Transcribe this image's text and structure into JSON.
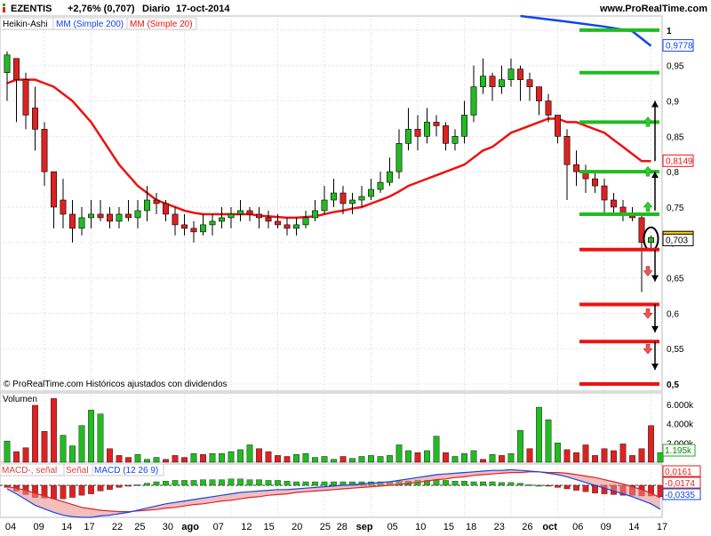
{
  "header": {
    "ticker": "EZENTIS",
    "change": "+2,76% (0,707)",
    "period": "Diario",
    "date": "17-oct-2014",
    "site": "www.ProRealTime.com"
  },
  "legend": {
    "heikin": "Heikin-Ashi",
    "sma200": "MM (Simple 200)",
    "sma20": "MM (Simple 20)"
  },
  "footer_note": "© ProRealTime.com  Históricos ajustados con dividendos",
  "colors": {
    "up": "#22bb22",
    "down": "#dd2222",
    "sma20": "#ee1111",
    "sma200": "#1144ee",
    "grid": "#d8d8d8",
    "volume_up": "#22bb22",
    "volume_down": "#dd2222"
  },
  "chart_data": [
    {
      "type": "candlestick",
      "title": "EZENTIS",
      "ylim": [
        0.49,
        1.02
      ],
      "yticks": [
        "1",
        "0,95",
        "0,9",
        "0,85",
        "0,8",
        "0,75",
        "0,7",
        "0,65",
        "0,6",
        "0,55",
        "0,5"
      ],
      "ytick_values": [
        1,
        0.95,
        0.9,
        0.85,
        0.8,
        0.75,
        0.7,
        0.65,
        0.6,
        0.55,
        0.5
      ],
      "price_tags": [
        {
          "label": "0,9778",
          "value": 0.9778,
          "color": "#1144ee"
        },
        {
          "label": "0,8149",
          "value": 0.8149,
          "color": "#ee1111"
        },
        {
          "label": "0,707",
          "value": 0.707,
          "color": "#000000",
          "highlight": true
        },
        {
          "label": "0,703",
          "value": 0.703,
          "color": "#000000"
        }
      ],
      "x_labels": [
        "04",
        "09",
        "14",
        "17",
        "22",
        "25",
        "30",
        "ago",
        "07",
        "12",
        "15",
        "20",
        "25",
        "28",
        "sep",
        "05",
        "10",
        "15",
        "18",
        "23",
        "26",
        "oct",
        "06",
        "09",
        "14",
        "17"
      ],
      "candles": [
        {
          "o": 0.94,
          "c": 0.965,
          "h": 0.97,
          "l": 0.9
        },
        {
          "o": 0.96,
          "c": 0.93,
          "h": 0.96,
          "l": 0.87
        },
        {
          "o": 0.93,
          "c": 0.88,
          "h": 0.94,
          "l": 0.86
        },
        {
          "o": 0.89,
          "c": 0.86,
          "h": 0.92,
          "l": 0.83
        },
        {
          "o": 0.86,
          "c": 0.8,
          "h": 0.87,
          "l": 0.78
        },
        {
          "o": 0.8,
          "c": 0.75,
          "h": 0.8,
          "l": 0.72
        },
        {
          "o": 0.76,
          "c": 0.74,
          "h": 0.79,
          "l": 0.72
        },
        {
          "o": 0.74,
          "c": 0.72,
          "h": 0.76,
          "l": 0.7
        },
        {
          "o": 0.72,
          "c": 0.735,
          "h": 0.75,
          "l": 0.71
        },
        {
          "o": 0.735,
          "c": 0.74,
          "h": 0.76,
          "l": 0.72
        },
        {
          "o": 0.74,
          "c": 0.735,
          "h": 0.76,
          "l": 0.73
        },
        {
          "o": 0.74,
          "c": 0.73,
          "h": 0.75,
          "l": 0.72
        },
        {
          "o": 0.73,
          "c": 0.74,
          "h": 0.75,
          "l": 0.72
        },
        {
          "o": 0.74,
          "c": 0.735,
          "h": 0.76,
          "l": 0.73
        },
        {
          "o": 0.735,
          "c": 0.745,
          "h": 0.76,
          "l": 0.72
        },
        {
          "o": 0.745,
          "c": 0.76,
          "h": 0.78,
          "l": 0.73
        },
        {
          "o": 0.76,
          "c": 0.755,
          "h": 0.77,
          "l": 0.74
        },
        {
          "o": 0.755,
          "c": 0.74,
          "h": 0.76,
          "l": 0.73
        },
        {
          "o": 0.74,
          "c": 0.725,
          "h": 0.75,
          "l": 0.71
        },
        {
          "o": 0.725,
          "c": 0.72,
          "h": 0.74,
          "l": 0.71
        },
        {
          "o": 0.72,
          "c": 0.715,
          "h": 0.73,
          "l": 0.7
        },
        {
          "o": 0.715,
          "c": 0.725,
          "h": 0.74,
          "l": 0.71
        },
        {
          "o": 0.725,
          "c": 0.73,
          "h": 0.74,
          "l": 0.71
        },
        {
          "o": 0.73,
          "c": 0.735,
          "h": 0.75,
          "l": 0.72
        },
        {
          "o": 0.735,
          "c": 0.74,
          "h": 0.75,
          "l": 0.72
        },
        {
          "o": 0.74,
          "c": 0.745,
          "h": 0.76,
          "l": 0.73
        },
        {
          "o": 0.745,
          "c": 0.74,
          "h": 0.75,
          "l": 0.73
        },
        {
          "o": 0.74,
          "c": 0.735,
          "h": 0.75,
          "l": 0.72
        },
        {
          "o": 0.735,
          "c": 0.73,
          "h": 0.745,
          "l": 0.72
        },
        {
          "o": 0.73,
          "c": 0.725,
          "h": 0.74,
          "l": 0.72
        },
        {
          "o": 0.725,
          "c": 0.72,
          "h": 0.735,
          "l": 0.71
        },
        {
          "o": 0.72,
          "c": 0.725,
          "h": 0.735,
          "l": 0.71
        },
        {
          "o": 0.725,
          "c": 0.735,
          "h": 0.745,
          "l": 0.72
        },
        {
          "o": 0.735,
          "c": 0.745,
          "h": 0.76,
          "l": 0.73
        },
        {
          "o": 0.745,
          "c": 0.76,
          "h": 0.78,
          "l": 0.74
        },
        {
          "o": 0.76,
          "c": 0.77,
          "h": 0.79,
          "l": 0.75
        },
        {
          "o": 0.77,
          "c": 0.755,
          "h": 0.78,
          "l": 0.74
        },
        {
          "o": 0.755,
          "c": 0.76,
          "h": 0.77,
          "l": 0.74
        },
        {
          "o": 0.76,
          "c": 0.765,
          "h": 0.78,
          "l": 0.75
        },
        {
          "o": 0.765,
          "c": 0.775,
          "h": 0.79,
          "l": 0.76
        },
        {
          "o": 0.775,
          "c": 0.785,
          "h": 0.8,
          "l": 0.77
        },
        {
          "o": 0.785,
          "c": 0.8,
          "h": 0.82,
          "l": 0.78
        },
        {
          "o": 0.8,
          "c": 0.84,
          "h": 0.86,
          "l": 0.79
        },
        {
          "o": 0.84,
          "c": 0.86,
          "h": 0.89,
          "l": 0.83
        },
        {
          "o": 0.86,
          "c": 0.85,
          "h": 0.88,
          "l": 0.83
        },
        {
          "o": 0.85,
          "c": 0.87,
          "h": 0.89,
          "l": 0.84
        },
        {
          "o": 0.87,
          "c": 0.865,
          "h": 0.88,
          "l": 0.85
        },
        {
          "o": 0.865,
          "c": 0.84,
          "h": 0.87,
          "l": 0.83
        },
        {
          "o": 0.84,
          "c": 0.85,
          "h": 0.86,
          "l": 0.83
        },
        {
          "o": 0.85,
          "c": 0.88,
          "h": 0.9,
          "l": 0.84
        },
        {
          "o": 0.88,
          "c": 0.92,
          "h": 0.95,
          "l": 0.87
        },
        {
          "o": 0.92,
          "c": 0.935,
          "h": 0.96,
          "l": 0.91
        },
        {
          "o": 0.935,
          "c": 0.92,
          "h": 0.94,
          "l": 0.9
        },
        {
          "o": 0.92,
          "c": 0.93,
          "h": 0.95,
          "l": 0.91
        },
        {
          "o": 0.93,
          "c": 0.945,
          "h": 0.96,
          "l": 0.92
        },
        {
          "o": 0.945,
          "c": 0.93,
          "h": 0.95,
          "l": 0.9
        },
        {
          "o": 0.93,
          "c": 0.92,
          "h": 0.94,
          "l": 0.9
        },
        {
          "o": 0.92,
          "c": 0.9,
          "h": 0.92,
          "l": 0.88
        },
        {
          "o": 0.9,
          "c": 0.88,
          "h": 0.91,
          "l": 0.87
        },
        {
          "o": 0.88,
          "c": 0.85,
          "h": 0.88,
          "l": 0.84
        },
        {
          "o": 0.85,
          "c": 0.81,
          "h": 0.86,
          "l": 0.76
        },
        {
          "o": 0.81,
          "c": 0.8,
          "h": 0.83,
          "l": 0.78
        },
        {
          "o": 0.8,
          "c": 0.79,
          "h": 0.81,
          "l": 0.77
        },
        {
          "o": 0.79,
          "c": 0.78,
          "h": 0.8,
          "l": 0.77
        },
        {
          "o": 0.78,
          "c": 0.76,
          "h": 0.79,
          "l": 0.74
        },
        {
          "o": 0.76,
          "c": 0.75,
          "h": 0.77,
          "l": 0.74
        },
        {
          "o": 0.75,
          "c": 0.74,
          "h": 0.76,
          "l": 0.73
        },
        {
          "o": 0.74,
          "c": 0.735,
          "h": 0.75,
          "l": 0.73
        },
        {
          "o": 0.735,
          "c": 0.7,
          "h": 0.74,
          "l": 0.63
        },
        {
          "o": 0.7,
          "c": 0.707,
          "h": 0.71,
          "l": 0.69
        }
      ],
      "sma20": [
        0.925,
        0.93,
        0.93,
        0.93,
        0.925,
        0.92,
        0.91,
        0.9,
        0.885,
        0.87,
        0.85,
        0.83,
        0.81,
        0.795,
        0.78,
        0.77,
        0.76,
        0.755,
        0.75,
        0.745,
        0.742,
        0.74,
        0.74,
        0.74,
        0.74,
        0.74,
        0.74,
        0.738,
        0.737,
        0.736,
        0.735,
        0.735,
        0.736,
        0.737,
        0.74,
        0.743,
        0.745,
        0.748,
        0.75,
        0.755,
        0.76,
        0.765,
        0.772,
        0.78,
        0.785,
        0.79,
        0.795,
        0.8,
        0.805,
        0.81,
        0.82,
        0.83,
        0.835,
        0.845,
        0.855,
        0.86,
        0.865,
        0.87,
        0.875,
        0.875,
        0.87,
        0.87,
        0.865,
        0.86,
        0.855,
        0.845,
        0.835,
        0.825,
        0.815,
        0.8149
      ],
      "sma200_points": [
        [
          55,
          1.02
        ],
        [
          60,
          1.012
        ],
        [
          64,
          1.005
        ],
        [
          67,
          0.9985
        ],
        [
          69,
          0.9778
        ]
      ],
      "green_levels": [
        1.0,
        0.94,
        0.87,
        0.8,
        0.74
      ],
      "red_levels": [
        0.69,
        0.6125,
        0.56,
        0.5
      ],
      "up_arrows": [
        0.87,
        0.8,
        0.75
      ],
      "down_arrows": [
        0.66,
        0.6,
        0.55
      ]
    },
    {
      "type": "bar",
      "title": "Volumen",
      "yticks": [
        "6.000k",
        "4.000k",
        "2.000k"
      ],
      "ytick_values": [
        6000,
        4000,
        2000
      ],
      "ylim": [
        0,
        7000
      ],
      "last_label": "1.195k",
      "values": [
        2200,
        1100,
        1500,
        5900,
        3200,
        6600,
        2800,
        1700,
        3800,
        5400,
        5000,
        1400,
        700,
        500,
        800,
        300,
        500,
        300,
        700,
        500,
        900,
        800,
        900,
        900,
        1100,
        1300,
        1800,
        1400,
        1100,
        700,
        600,
        800,
        900,
        500,
        600,
        300,
        600,
        400,
        600,
        700,
        600,
        700,
        1800,
        1200,
        1000,
        1200,
        2700,
        1000,
        600,
        900,
        1200,
        300,
        800,
        700,
        900,
        3300,
        1400,
        5700,
        4400,
        2000,
        1300,
        1000,
        1800,
        700,
        1400,
        1200,
        1900,
        700,
        1400,
        3800,
        1000
      ],
      "up": [
        true,
        false,
        false,
        false,
        false,
        false,
        true,
        true,
        true,
        true,
        true,
        false,
        false,
        false,
        true,
        true,
        true,
        false,
        false,
        false,
        true,
        false,
        true,
        true,
        true,
        true,
        true,
        false,
        false,
        false,
        false,
        true,
        true,
        true,
        true,
        true,
        false,
        true,
        true,
        true,
        true,
        true,
        true,
        true,
        false,
        true,
        true,
        false,
        true,
        true,
        true,
        false,
        true,
        false,
        true,
        true,
        false,
        true,
        true,
        true,
        false,
        false,
        false,
        false,
        false,
        false,
        false,
        false,
        false,
        false,
        true
      ]
    },
    {
      "type": "line",
      "title": "MACD",
      "legend": [
        "MACD-, señal",
        "Señal",
        "MACD (12 26 9)"
      ],
      "yticks": [
        "0,0161",
        "-0,0174",
        "-0,0335"
      ],
      "ytick_values": [
        0.0161,
        -0.0174,
        -0.0335
      ],
      "ylim": [
        -0.045,
        0.03
      ],
      "macd": [
        -0.005,
        -0.012,
        -0.02,
        -0.028,
        -0.033,
        -0.038,
        -0.042,
        -0.044,
        -0.045,
        -0.045,
        -0.043,
        -0.042,
        -0.04,
        -0.038,
        -0.035,
        -0.032,
        -0.029,
        -0.026,
        -0.024,
        -0.022,
        -0.02,
        -0.018,
        -0.016,
        -0.014,
        -0.012,
        -0.01,
        -0.009,
        -0.008,
        -0.007,
        -0.006,
        -0.006,
        -0.005,
        -0.004,
        -0.003,
        -0.002,
        -0.001,
        0,
        0.001,
        0.002,
        0.003,
        0.004,
        0.005,
        0.007,
        0.009,
        0.011,
        0.013,
        0.015,
        0.016,
        0.017,
        0.018,
        0.019,
        0.02,
        0.021,
        0.021,
        0.022,
        0.021,
        0.02,
        0.019,
        0.017,
        0.015,
        0.012,
        0.008,
        0.004,
        0.0,
        -0.004,
        -0.008,
        -0.012,
        -0.016,
        -0.021,
        -0.026,
        -0.0335
      ],
      "signal": [
        -0.002,
        -0.004,
        -0.007,
        -0.011,
        -0.015,
        -0.019,
        -0.023,
        -0.027,
        -0.031,
        -0.033,
        -0.035,
        -0.036,
        -0.037,
        -0.037,
        -0.036,
        -0.035,
        -0.034,
        -0.032,
        -0.031,
        -0.029,
        -0.027,
        -0.026,
        -0.024,
        -0.022,
        -0.021,
        -0.019,
        -0.017,
        -0.016,
        -0.014,
        -0.013,
        -0.012,
        -0.01,
        -0.009,
        -0.008,
        -0.007,
        -0.006,
        -0.005,
        -0.004,
        -0.003,
        -0.002,
        -0.001,
        0.0,
        0.001,
        0.003,
        0.004,
        0.006,
        0.008,
        0.009,
        0.011,
        0.012,
        0.014,
        0.015,
        0.016,
        0.017,
        0.018,
        0.018,
        0.019,
        0.019,
        0.018,
        0.018,
        0.017,
        0.015,
        0.013,
        0.011,
        0.008,
        0.005,
        0.002,
        -0.002,
        -0.006,
        -0.011,
        -0.0174
      ]
    }
  ]
}
